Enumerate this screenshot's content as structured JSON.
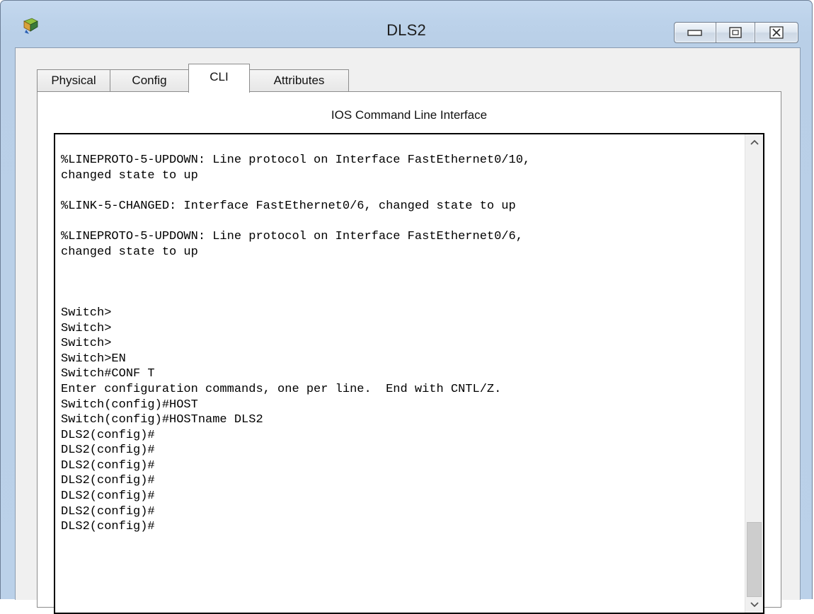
{
  "window": {
    "title": "DLS2",
    "icon": "packet-tracer-app-icon",
    "controls": [
      "minimize-icon",
      "maximize-icon",
      "close-icon"
    ]
  },
  "tabs": [
    {
      "label": "Physical",
      "active": false
    },
    {
      "label": "Config",
      "active": false
    },
    {
      "label": "CLI",
      "active": true
    },
    {
      "label": "Attributes",
      "active": false
    }
  ],
  "panel": {
    "title": "IOS Command Line Interface"
  },
  "terminal": {
    "lines": [
      "%LINEPROTO-5-UPDOWN: Line protocol on Interface FastEthernet0/10,",
      "changed state to up",
      "",
      "%LINK-5-CHANGED: Interface FastEthernet0/6, changed state to up",
      "",
      "%LINEPROTO-5-UPDOWN: Line protocol on Interface FastEthernet0/6,",
      "changed state to up",
      "",
      "",
      "",
      "Switch>",
      "Switch>",
      "Switch>",
      "Switch>EN",
      "Switch#CONF T",
      "Enter configuration commands, one per line.  End with CNTL/Z.",
      "Switch(config)#HOST",
      "Switch(config)#HOSTname DLS2",
      "DLS2(config)#",
      "DLS2(config)#",
      "DLS2(config)#",
      "DLS2(config)#",
      "DLS2(config)#",
      "DLS2(config)#",
      "DLS2(config)#"
    ],
    "scroll_position": 0.95
  },
  "colors": {
    "title_bar": "#c4d8ee",
    "client_bg": "#f0f0f0",
    "terminal_border": "#000000"
  }
}
